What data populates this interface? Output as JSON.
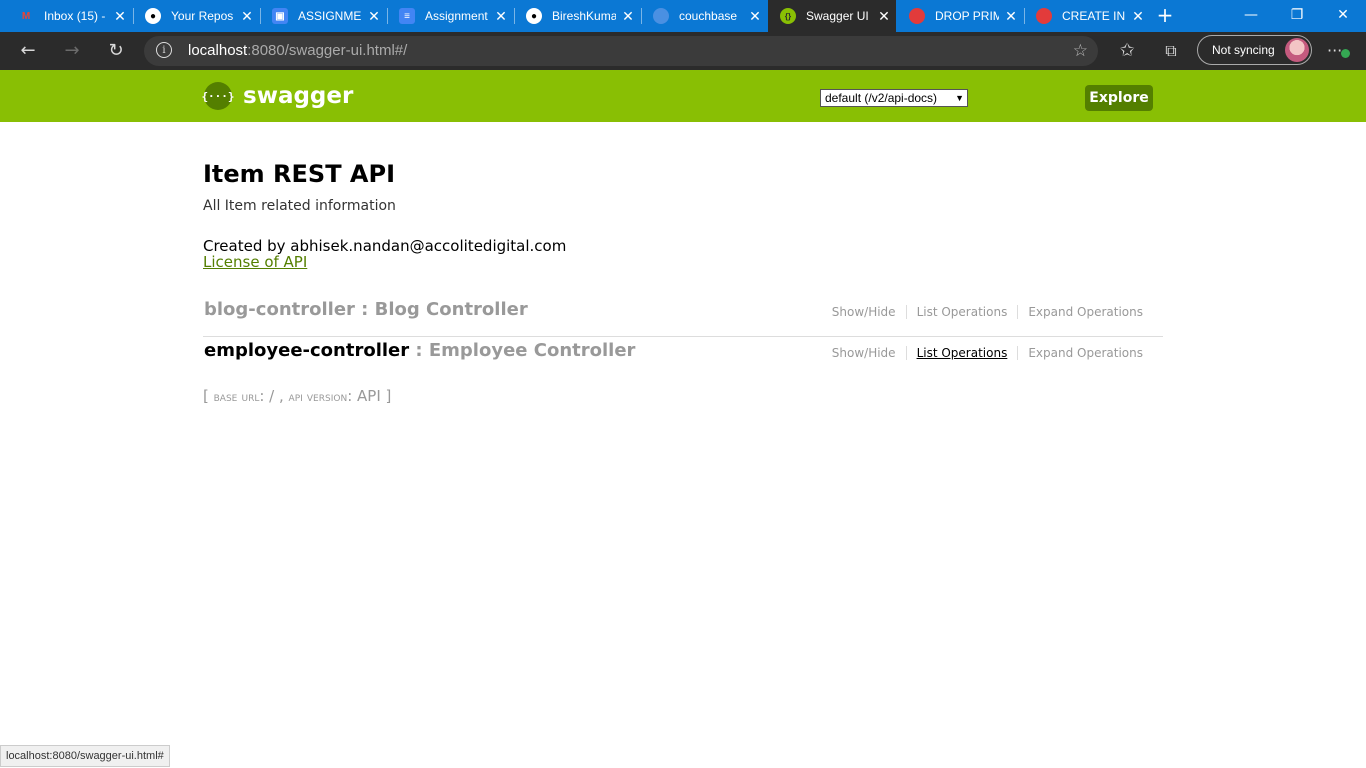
{
  "browser": {
    "tabs": [
      {
        "title": "Inbox (15) -",
        "icon": "gmail-icon",
        "fav_color": "#ea4335",
        "fav_text": "M",
        "active": false
      },
      {
        "title": "Your Repos",
        "icon": "github-icon",
        "fav_color": "#ffffff",
        "fav_text": "●",
        "active": false
      },
      {
        "title": "ASSIGNMEN",
        "icon": "contacts-icon",
        "fav_color": "#4285f4",
        "fav_text": "▣",
        "active": false
      },
      {
        "title": "Assignment",
        "icon": "docs-icon",
        "fav_color": "#4285f4",
        "fav_text": "≡",
        "active": false
      },
      {
        "title": "BireshKuma",
        "icon": "github-icon",
        "fav_color": "#ffffff",
        "fav_text": "●",
        "active": false
      },
      {
        "title": "couchbase",
        "icon": "couchbase-icon",
        "fav_color": "#4a90e2",
        "fav_text": "●",
        "active": false
      },
      {
        "title": "Swagger UI",
        "icon": "swagger-icon",
        "fav_color": "#89bf04",
        "fav_text": "{}",
        "active": true
      },
      {
        "title": "DROP PRIM",
        "icon": "couchbase-red-icon",
        "fav_color": "#e23b3b",
        "fav_text": "●",
        "active": false
      },
      {
        "title": "CREATE INI",
        "icon": "couchbase-red-icon",
        "fav_color": "#e23b3b",
        "fav_text": "●",
        "active": false
      }
    ],
    "url_host": "localhost",
    "url_rest": ":8080/swagger-ui.html#/",
    "sync_label": "Not syncing",
    "status_url": "localhost:8080/swagger-ui.html#"
  },
  "swagger": {
    "brand": "swagger",
    "select_value": "default (/v2/api-docs)",
    "explore_label": "Explore"
  },
  "info": {
    "title": "Item REST API",
    "description": "All Item related information",
    "created_by": "Created by abhisek.nandan@accolitedigital.com",
    "license": "License of API"
  },
  "resources": [
    {
      "name": "blog-controller",
      "separator": " : ",
      "description": "Blog Controller"
    },
    {
      "name": "employee-controller",
      "separator": " : ",
      "description": "Employee Controller"
    }
  ],
  "ops_labels": {
    "show_hide": "Show/Hide",
    "list": "List Operations",
    "expand": "Expand Operations"
  },
  "footer": {
    "open": "[ ",
    "base_url_label": "base url",
    "base_url_value": ": / , ",
    "api_version_label": "api version",
    "api_version_value": ": API",
    "close": " ]"
  },
  "colors": {
    "swagger_green": "#89bf04",
    "dark_green": "#547f00",
    "tab_bar": "#0b78d4"
  }
}
